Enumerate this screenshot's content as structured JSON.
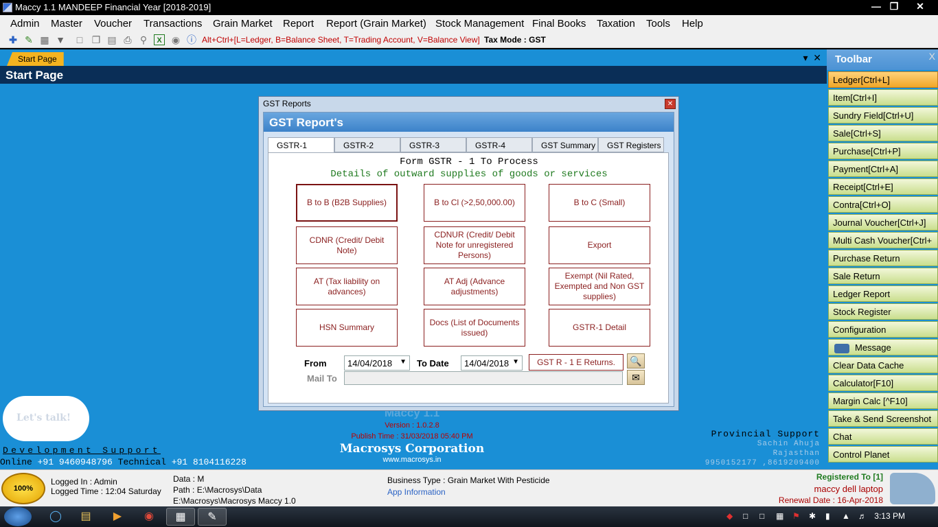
{
  "window": {
    "title": "Maccy 1.1 MANDEEP Financial Year [2018-2019]"
  },
  "menu": [
    "Admin",
    "Master",
    "Voucher",
    "Transactions",
    "Grain Market",
    "Report",
    "Report (Grain Market)",
    "Stock Management",
    "Final Books",
    "Taxation",
    "Tools",
    "Help"
  ],
  "toolstrip": {
    "hint": "Alt+Ctrl+[L=Ledger, B=Balance Sheet, T=Trading Account, V=Balance View]",
    "tax_mode": "Tax Mode : GST"
  },
  "doc": {
    "tab_label": "Start Page",
    "page_title": "Start Page"
  },
  "dialog": {
    "title": "GST Reports",
    "banner": "GST Report's",
    "tabs": [
      "GSTR-1",
      "GSTR-2",
      "GSTR-3",
      "GSTR-4",
      "GST Summary",
      "GST Registers"
    ],
    "form_title": "Form GSTR - 1 To Process",
    "form_subtitle": "Details of outward supplies of goods or services",
    "buttons": [
      "B to B (B2B Supplies)",
      "B to Cl (>2,50,000.00)",
      "B to C (Small)",
      "CDNR (Credit/ Debit Note)",
      "CDNUR (Credit/ Debit Note for unregistered Persons)",
      "Export",
      "AT (Tax liability on advances)",
      "AT Adj (Advance adjustments)",
      "Exempt (Nil Rated, Exempted and Non GST supplies)",
      "HSN Summary",
      "Docs (List of Documents issued)",
      "GSTR-1 Detail"
    ],
    "from_label": "From",
    "from_value": "14/04/2018",
    "to_label": "To Date",
    "to_value": "14/04/2018",
    "returns_button": "GST R - 1 E Returns.",
    "mail_label": "Mail To",
    "mail_value": ""
  },
  "start_page": {
    "bubble": "Let's talk!",
    "dev_support": "Development Support",
    "online_label": "Online",
    "online_number": "+91 9460948796",
    "technical_label": "Technical",
    "technical_number": "+91 8104116228",
    "app_name_ghost": "Maccy 1.1",
    "version": "Version : 1.0.2.8",
    "publish_time": "Publish Time : 31/03/2018 05:40 PM",
    "corporation": "Macrosys Corporation",
    "website": "www.macrosys.in",
    "provincial_title": "Provincial Support",
    "provincial_name": "Sachin Ahuja",
    "provincial_state": "Rajasthan",
    "provincial_phones": "9950152177 ,8619209400"
  },
  "right_toolbar": {
    "title": "Toolbar",
    "close": "X",
    "items": [
      "Ledger[Ctrl+L]",
      "Item[Ctrl+I]",
      "Sundry Field[Ctrl+U]",
      "Sale[Ctrl+S]",
      "Purchase[Ctrl+P]",
      "Payment[Ctrl+A]",
      "Receipt[Ctrl+E]",
      "Contra[Ctrl+O]",
      "Journal Voucher[Ctrl+J]",
      "Multi Cash Voucher[Ctrl+",
      "Purchase Return",
      "Sale Return",
      "Ledger Report",
      "Stock Register",
      "Configuration",
      "Message",
      "Clear Data Cache",
      "Calculator[F10]",
      "Margin Calc [^F10]",
      "Take & Send Screenshot",
      "Chat",
      "Control Planet"
    ]
  },
  "status": {
    "badge": "100%",
    "logged_in": "Logged In : Admin",
    "logged_time": "Logged Time : 12:04 Saturday",
    "data": "Data : M",
    "path": "Path : E:\\Macrosys\\Data",
    "exe_path": "E:\\Macrosys\\Macrosys Maccy 1.0",
    "business_type": "Business Type : Grain Market With Pesticide",
    "app_info": "App Information",
    "registered_to": "Registered To [1]",
    "registered_name": "maccy dell laptop",
    "renewal": "Renewal Date : 16-Apr-2018"
  },
  "taskbar": {
    "clock": "3:13 PM"
  }
}
